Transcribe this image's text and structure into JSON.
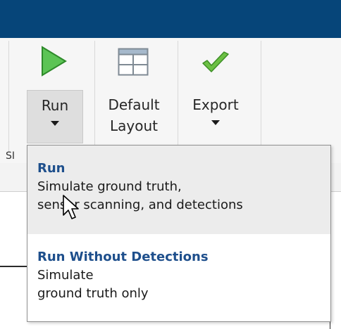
{
  "toolstrip": {
    "run": {
      "label": "Run",
      "icon": "play-icon",
      "color": "#4cb848"
    },
    "default_layout": {
      "label_line1": "Default",
      "label_line2": "Layout",
      "icon": "layout-grid-icon"
    },
    "export": {
      "label": "Export",
      "icon": "checkmark-icon",
      "color": "#5fb83a"
    },
    "section_label": "SI"
  },
  "run_menu": {
    "items": [
      {
        "title": "Run",
        "description_line1": "Simulate ground truth,",
        "description_line2": "sensor scanning, and detections"
      },
      {
        "title": "Run Without Detections",
        "description_line1": "Simulate",
        "description_line2": "ground truth only"
      }
    ]
  },
  "colors": {
    "titlebar": "#064579",
    "menu_title": "#1e4f8c"
  }
}
